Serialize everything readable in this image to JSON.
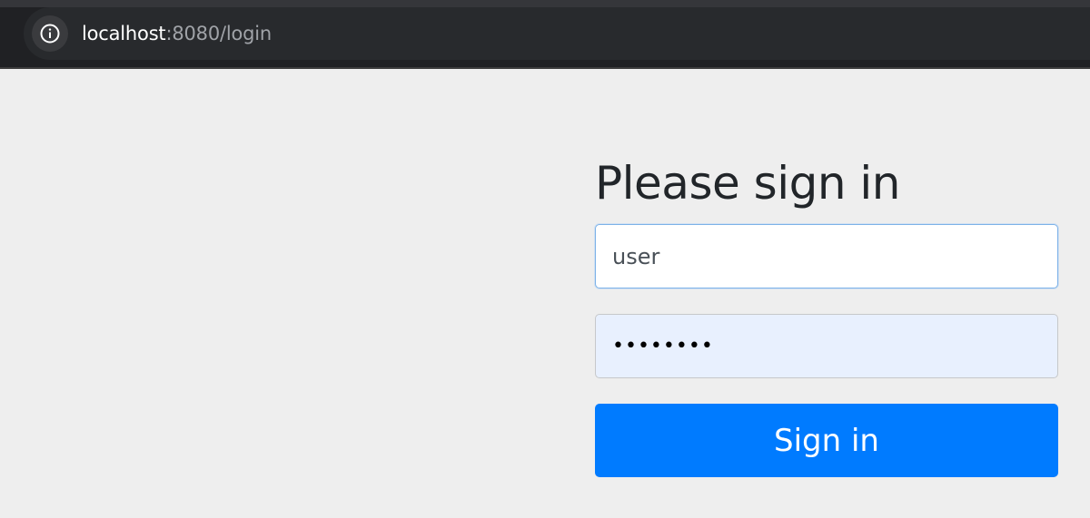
{
  "browser": {
    "url_host": "localhost",
    "url_rest": ":8080/login",
    "site_info_icon": "info-circle-icon"
  },
  "form": {
    "heading": "Please sign in",
    "username_value": "user",
    "password_value": "••••••••",
    "submit_label": "Sign in"
  },
  "colors": {
    "page_background": "#eeeeee",
    "primary_button": "#007bff",
    "autofill_background": "#e8f0fe",
    "browser_toolbar": "#202124"
  }
}
